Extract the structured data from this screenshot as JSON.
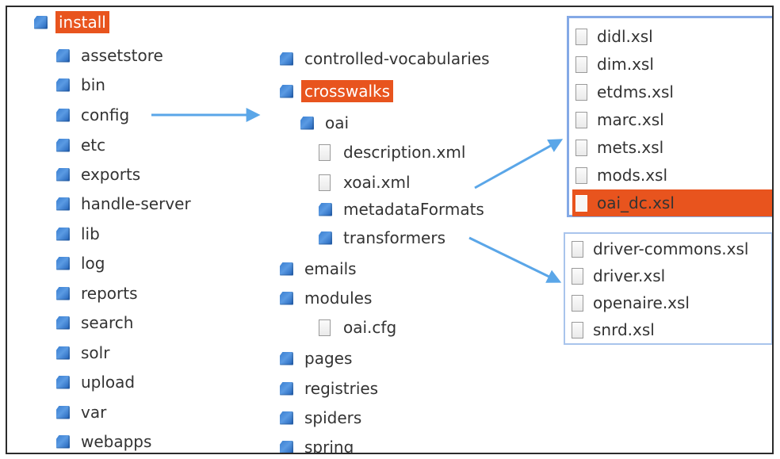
{
  "tree_root": {
    "label": "install",
    "icon": "folder-icon",
    "highlight": "#e8541e"
  },
  "install_children": [
    "assetstore",
    "bin",
    "config",
    "etc",
    "exports",
    "handle-server",
    "lib",
    "log",
    "reports",
    "search",
    "solr",
    "upload",
    "var",
    "webapps"
  ],
  "config": {
    "children": [
      {
        "label": "controlled-vocabularies",
        "type": "folder"
      },
      {
        "label": "crosswalks",
        "type": "folder",
        "highlight": true
      },
      {
        "label": "oai",
        "type": "folder"
      },
      {
        "label": "description.xml",
        "type": "file"
      },
      {
        "label": "xoai.xml",
        "type": "file"
      },
      {
        "label": "metadataFormats",
        "type": "folder"
      },
      {
        "label": "transformers",
        "type": "folder"
      },
      {
        "label": "emails",
        "type": "folder"
      },
      {
        "label": "modules",
        "type": "folder"
      },
      {
        "label": "oai.cfg",
        "type": "file"
      },
      {
        "label": "pages",
        "type": "folder"
      },
      {
        "label": "registries",
        "type": "folder"
      },
      {
        "label": "spiders",
        "type": "folder"
      },
      {
        "label": "spring",
        "type": "folder"
      }
    ]
  },
  "metadata_formats_files": [
    "didl.xsl",
    "dim.xsl",
    "etdms.xsl",
    "marc.xsl",
    "mets.xsl",
    "mods.xsl",
    "oai_dc.xsl"
  ],
  "metadata_formats_selected": "oai_dc.xsl",
  "transformers_files": [
    "driver-commons.xsl",
    "driver.xsl",
    "openaire.xsl",
    "snrd.xsl"
  ],
  "colors": {
    "highlight": "#e8541e",
    "arrow": "#5aa6e8",
    "folder": "#2f74cc",
    "panel_border": "#84a9e6"
  }
}
